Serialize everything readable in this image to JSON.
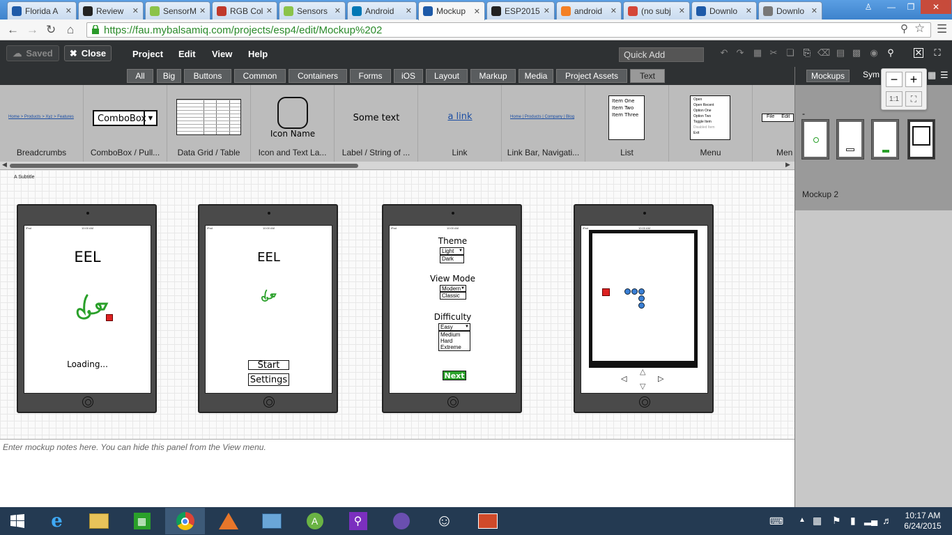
{
  "browser": {
    "tabs": [
      {
        "label": "Florida A",
        "icon": "smiley-icon",
        "color": "#1e5aa8"
      },
      {
        "label": "Review",
        "icon": "blackboard-icon",
        "color": "#222222"
      },
      {
        "label": "SensorM",
        "icon": "android-icon",
        "color": "#8bc34a"
      },
      {
        "label": "RGB Col",
        "icon": "r-icon",
        "color": "#c0392b"
      },
      {
        "label": "Sensors",
        "icon": "android-icon",
        "color": "#8bc34a"
      },
      {
        "label": "Android",
        "icon": "linkedin-icon",
        "color": "#0077b5"
      },
      {
        "label": "Mockup",
        "icon": "smiley-icon",
        "color": "#1e5aa8"
      },
      {
        "label": "ESP2015",
        "icon": "github-icon",
        "color": "#222222"
      },
      {
        "label": "android",
        "icon": "stackoverflow-icon",
        "color": "#f48024"
      },
      {
        "label": "(no subj",
        "icon": "gmail-icon",
        "color": "#d44638"
      },
      {
        "label": "Downlo",
        "icon": "smiley-icon",
        "color": "#1e5aa8"
      },
      {
        "label": "Downlo",
        "icon": "download-icon",
        "color": "#777777"
      }
    ],
    "active_tab": 6,
    "url": "https://fau.mybalsamiq.com/projects/esp4/edit/Mockup%202"
  },
  "appbar": {
    "saved": "Saved",
    "close": "Close",
    "menus": [
      "Project",
      "Edit",
      "View",
      "Help"
    ],
    "quick_add": "Quick Add"
  },
  "categories": [
    "All",
    "Big",
    "Buttons",
    "Common",
    "Containers",
    "Forms",
    "iOS",
    "Layout",
    "Markup",
    "Media",
    "Project Assets",
    "Text"
  ],
  "active_category": "Text",
  "library": {
    "items": [
      "Breadcrumbs",
      "ComboBox / Pull...",
      "Data Grid / Table",
      "Icon and Text La...",
      "Label / String of ...",
      "Link",
      "Link Bar, Navigati...",
      "List",
      "Menu",
      "Men"
    ],
    "breadcrumb_sample": "Home > Products > Xyz > Features",
    "combobox_sample": "ComboBox",
    "icon_name_sample": "Icon Name",
    "label_sample": "Some text",
    "link_sample": "a link",
    "linkbar_sample": "Home | Products | Company | Blog",
    "list_sample": [
      "Item One",
      "Item Two",
      "Item Three"
    ],
    "menu_sample": [
      "Open",
      "Open Recent",
      "Option One",
      "Option Two",
      "Toggle Item",
      "Disabled Item",
      "Exit"
    ],
    "menubar_sample": [
      "File",
      "Edit"
    ]
  },
  "right_panel": {
    "tabs": [
      "Mockups",
      "Sym"
    ],
    "active_mockup": "Mockup 2",
    "dash": "-",
    "zoom_one": "1:1"
  },
  "canvas": {
    "subtitle": "A Subtitle",
    "screen1": {
      "title": "EEL",
      "status": "Loading..."
    },
    "screen2": {
      "title": "EEL",
      "start": "Start",
      "settings": "Settings"
    },
    "screen3": {
      "theme_label": "Theme",
      "theme_options": [
        "Light",
        "Dark"
      ],
      "view_label": "View Mode",
      "view_options": [
        "Modern",
        "Classic"
      ],
      "difficulty_label": "Difficulty",
      "difficulty_selected": "Easy",
      "difficulty_options": [
        "Medium",
        "Hard",
        "Extreme"
      ],
      "next": "Next"
    },
    "status_bar": {
      "carrier": "iPad",
      "time": "10:00 AM"
    }
  },
  "notes_placeholder": "Enter mockup notes here. You can hide this panel from the View menu.",
  "taskbar": {
    "time": "10:17 AM",
    "date": "6/24/2015"
  },
  "colors": {
    "accent_green": "#2aa02a",
    "red_block": "#dd2222",
    "snake_blue": "#3a7fd5"
  }
}
